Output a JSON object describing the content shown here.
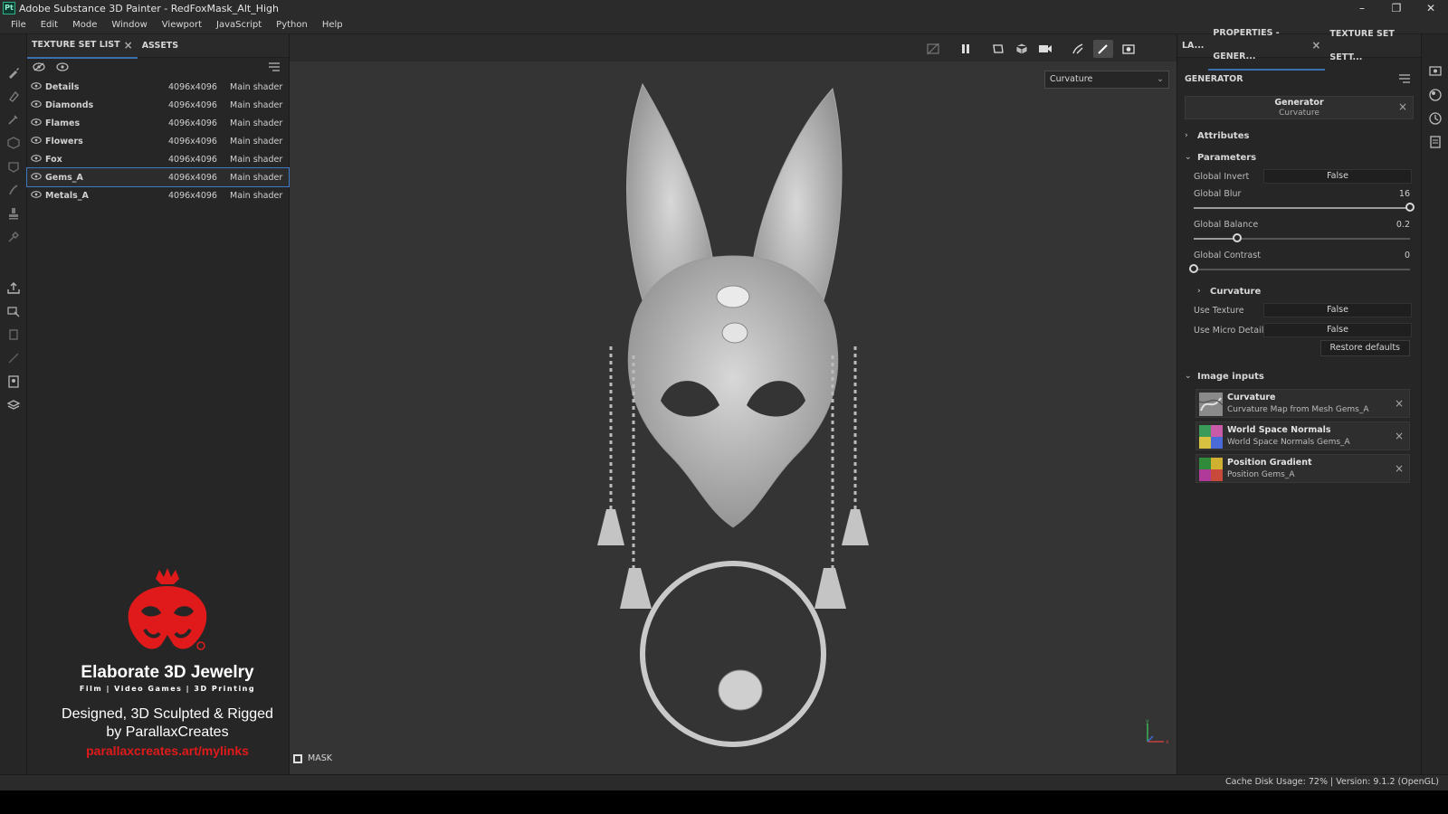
{
  "window": {
    "title": "Adobe Substance 3D Painter - RedFoxMask_Alt_High",
    "app_icon": "Pt",
    "controls": {
      "minimize": "–",
      "restore": "❐",
      "close": "✕"
    }
  },
  "menu": [
    "File",
    "Edit",
    "Mode",
    "Window",
    "Viewport",
    "JavaScript",
    "Python",
    "Help"
  ],
  "left_panel": {
    "tabs": [
      {
        "label": "TEXTURE SET LIST",
        "active": true,
        "closable": true
      },
      {
        "label": "ASSETS",
        "active": false,
        "closable": false
      }
    ],
    "texture_sets": [
      {
        "name": "Details",
        "resolution": "4096x4096",
        "shader": "Main shader"
      },
      {
        "name": "Diamonds",
        "resolution": "4096x4096",
        "shader": "Main shader"
      },
      {
        "name": "Flames",
        "resolution": "4096x4096",
        "shader": "Main shader"
      },
      {
        "name": "Flowers",
        "resolution": "4096x4096",
        "shader": "Main shader"
      },
      {
        "name": "Fox",
        "resolution": "4096x4096",
        "shader": "Main shader"
      },
      {
        "name": "Gems_A",
        "resolution": "4096x4096",
        "shader": "Main shader",
        "selected": true
      },
      {
        "name": "Metals_A",
        "resolution": "4096x4096",
        "shader": "Main shader"
      }
    ]
  },
  "promo": {
    "title": "Elaborate 3D Jewelry",
    "subtitle": "Film | Video Games | 3D Printing",
    "credit_line1": "Designed, 3D Sculpted & Rigged",
    "credit_line2": "by ParallaxCreates",
    "link": "parallaxcreates.art/mylinks",
    "logo_color": "#e01a1a"
  },
  "viewport": {
    "channel_dropdown": "Curvature",
    "mask_label": "MASK",
    "axis_y": "y",
    "axis_x": "x"
  },
  "right_panel": {
    "tabs": [
      {
        "label": "LA...",
        "active": false
      },
      {
        "label": "PROPERTIES - GENER...",
        "active": true,
        "closable": true
      },
      {
        "label": "TEXTURE SET SETT...",
        "active": false
      }
    ],
    "header": "GENERATOR",
    "generator": {
      "title": "Generator",
      "type": "Curvature"
    },
    "sections": {
      "attributes": "Attributes",
      "parameters": "Parameters",
      "curvature": "Curvature",
      "image_inputs": "Image inputs"
    },
    "params": {
      "global_invert": {
        "label": "Global Invert",
        "value": "False"
      },
      "global_blur": {
        "label": "Global Blur",
        "value": "16",
        "fraction": 1.0
      },
      "global_balance": {
        "label": "Global Balance",
        "value": "0.2",
        "fraction": 0.2
      },
      "global_contrast": {
        "label": "Global Contrast",
        "value": "0",
        "fraction": 0.0
      },
      "use_texture": {
        "label": "Use Texture",
        "value": "False"
      },
      "use_micro_details": {
        "label": "Use Micro Details",
        "value": "False"
      },
      "restore_defaults": "Restore defaults"
    },
    "image_inputs": [
      {
        "name": "Curvature",
        "desc": "Curvature Map from Mesh Gems_A"
      },
      {
        "name": "World Space Normals",
        "desc": "World Space Normals Gems_A"
      },
      {
        "name": "Position Gradient",
        "desc": "Position Gems_A"
      }
    ]
  },
  "status": {
    "text": "Cache Disk Usage:   72% | Version: 9.1.2 (OpenGL)"
  },
  "colors": {
    "accent": "#3c78c6",
    "panel_bg": "#262626",
    "viewport_bg": "#343434"
  }
}
